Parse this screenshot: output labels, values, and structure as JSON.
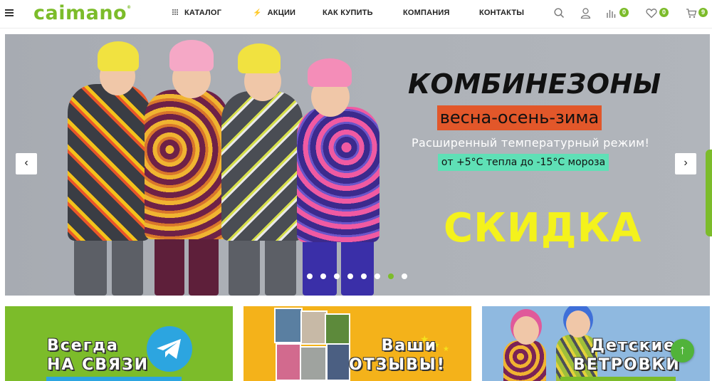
{
  "header": {
    "logo": "caimano",
    "logo_mark": "®",
    "nav": {
      "catalog": "КАТАЛОГ",
      "sales": "АКЦИИ",
      "how_to_buy": "КАК КУПИТЬ",
      "company": "КОМПАНИЯ",
      "contacts": "КОНТАКТЫ"
    },
    "compare_count": "0",
    "favorites_count": "0",
    "cart_count": "9"
  },
  "banner": {
    "headline": "КОМБИНЕЗОНЫ",
    "season": "весна-осень-зима",
    "temp_mode": "Расширенный температурный режим!",
    "temp_range": "от +5°C тепла до -15°C мороза",
    "sale": "СКИДКА",
    "prev_arrow": "‹",
    "next_arrow": "›",
    "slide_count": 8,
    "active_slide": 7
  },
  "cards": {
    "telegram": {
      "line1": "Всегда",
      "line2": "НА СВЯЗИ"
    },
    "reviews": {
      "line1": "Ваши",
      "line2": "ОТЗЫВЫ!"
    },
    "windbreakers": {
      "line1": "Детские",
      "line2": "ВЕТРОВКИ"
    }
  },
  "scroll_top": "↑",
  "colors": {
    "brand_green": "#7cbc2a",
    "season_bg": "#e2572a",
    "temp_bg": "#5fe0b6",
    "sale_yellow": "#f4f21c",
    "card_green": "#7cbc2a",
    "card_yellow": "#f4b21a",
    "card_blue": "#8fb9e0"
  },
  "icons": [
    "menu-icon",
    "grid-icon",
    "lightning-icon",
    "search-icon",
    "user-icon",
    "compare-chart-icon",
    "heart-icon",
    "cart-icon",
    "telegram-plane-icon",
    "arrow-up-icon"
  ]
}
